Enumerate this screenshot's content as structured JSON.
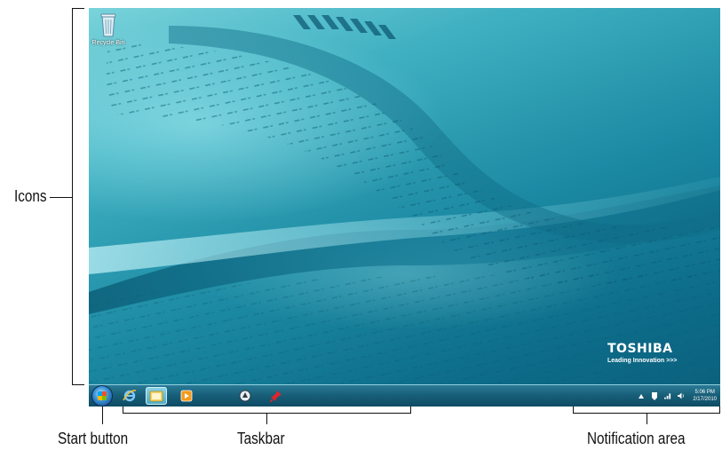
{
  "annotations": {
    "icons": "Icons",
    "start_button": "Start button",
    "taskbar": "Taskbar",
    "notification_area": "Notification area"
  },
  "desktop": {
    "icons": [
      {
        "label": "Recycle Bin",
        "icon": "recycle-bin-icon"
      }
    ]
  },
  "branding": {
    "name": "TOSHIBA",
    "tagline": "Leading Innovation >>>"
  },
  "taskbar": {
    "pinned": [
      {
        "icon": "internet-explorer-icon",
        "active": false
      },
      {
        "icon": "windows-explorer-icon",
        "active": true
      },
      {
        "icon": "media-player-icon",
        "active": false
      },
      {
        "icon": "app-icon",
        "active": false
      },
      {
        "icon": "pin-icon",
        "active": false
      }
    ]
  },
  "notification_area": {
    "icons": [
      "show-hidden-icons-icon",
      "action-center-icon",
      "network-icon",
      "volume-icon"
    ],
    "time": "5:06 PM",
    "date": "2/17/2010"
  },
  "colors": {
    "wallpaper_accent": "#1c8aa3",
    "taskbar": "#175d77"
  }
}
